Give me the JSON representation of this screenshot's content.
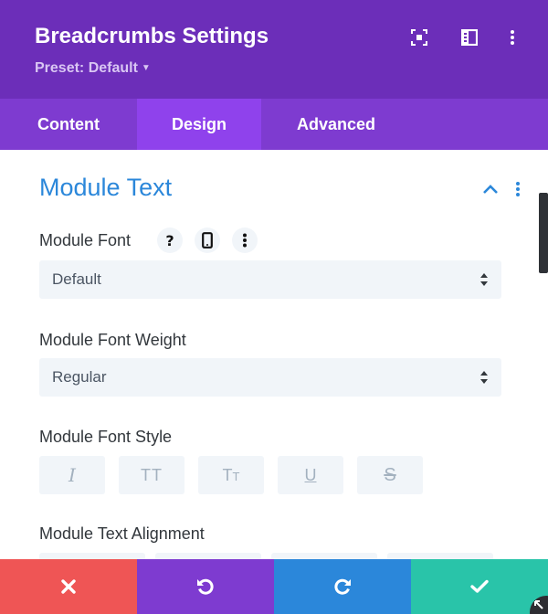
{
  "header": {
    "title": "Breadcrumbs Settings",
    "preset_label": "Preset: Default",
    "background": "#6c2eb9"
  },
  "tabs": [
    {
      "label": "Content",
      "active": false
    },
    {
      "label": "Design",
      "active": true
    },
    {
      "label": "Advanced",
      "active": false
    }
  ],
  "section": {
    "title": "Module Text",
    "accent": "#2b87da"
  },
  "fields": {
    "font": {
      "label": "Module Font",
      "value": "Default"
    },
    "weight": {
      "label": "Module Font Weight",
      "value": "Regular"
    },
    "style": {
      "label": "Module Font Style",
      "buttons": [
        "italic-icon",
        "uppercase-icon",
        "capitalize-icon",
        "underline-icon",
        "strikethrough-icon"
      ]
    },
    "alignment": {
      "label": "Module Text Alignment"
    }
  },
  "footer": {
    "buttons": [
      {
        "icon": "close-icon",
        "color": "#ef5555"
      },
      {
        "icon": "undo-icon",
        "color": "#7e3bd0"
      },
      {
        "icon": "redo-icon",
        "color": "#2b87da"
      },
      {
        "icon": "check-icon",
        "color": "#29c4a9"
      }
    ]
  }
}
